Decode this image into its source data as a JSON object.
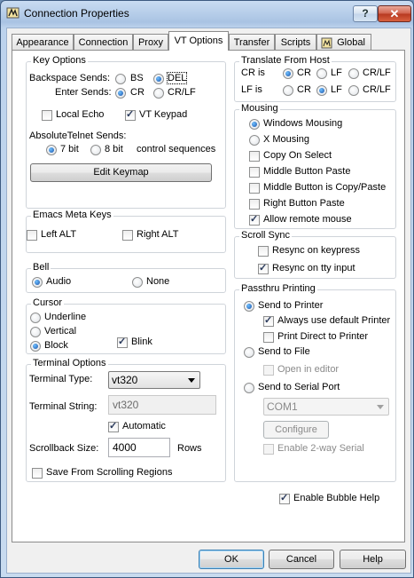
{
  "window": {
    "title": "Connection Properties",
    "help_glyph": "?",
    "close_glyph": "✕"
  },
  "tabs": [
    "Appearance",
    "Connection",
    "Proxy",
    "VT Options",
    "Transfer",
    "Scripts",
    "Global"
  ],
  "key_options": {
    "title": "Key Options",
    "backspace_label": "Backspace Sends:",
    "bs": "BS",
    "del": "DEL",
    "enter_label": "Enter Sends:",
    "cr": "CR",
    "crlf": "CR/LF",
    "local_echo": "Local Echo",
    "vt_keypad": "VT Keypad",
    "abs_telnet_label": "AbsoluteTelnet Sends:",
    "bit7": "7 bit",
    "bit8": "8 bit",
    "control_seq": "control sequences",
    "edit_keymap": "Edit Keymap"
  },
  "emacs": {
    "title": "Emacs Meta Keys",
    "left_alt": "Left ALT",
    "right_alt": "Right ALT"
  },
  "bell": {
    "title": "Bell",
    "audio": "Audio",
    "none": "None"
  },
  "cursor": {
    "title": "Cursor",
    "underline": "Underline",
    "vertical": "Vertical",
    "block": "Block",
    "blink": "Blink"
  },
  "terminal": {
    "title": "Terminal Options",
    "type_label": "Terminal Type:",
    "type_value": "vt320",
    "string_label": "Terminal String:",
    "string_value": "vt320",
    "automatic": "Automatic",
    "scrollback_label": "Scrollback Size:",
    "scrollback_value": "4000",
    "rows": "Rows",
    "save_scrolling": "Save From Scrolling Regions"
  },
  "translate": {
    "title": "Translate From Host",
    "cr_is": "CR is",
    "lf_is": "LF is",
    "cr": "CR",
    "lf": "LF",
    "crlf": "CR/LF"
  },
  "mousing": {
    "title": "Mousing",
    "windows": "Windows Mousing",
    "x": "X Mousing",
    "copy_on_select": "Copy On Select",
    "middle_paste": "Middle Button Paste",
    "middle_copy_paste": "Middle Button is Copy/Paste",
    "right_paste": "Right Button Paste",
    "allow_remote": "Allow remote mouse"
  },
  "scroll_sync": {
    "title": "Scroll Sync",
    "resync_keypress": "Resync on keypress",
    "resync_tty": "Resync on tty input"
  },
  "passthru": {
    "title": "Passthru Printing",
    "send_printer": "Send to Printer",
    "default_printer": "Always use default Printer",
    "print_direct": "Print Direct to Printer",
    "send_file": "Send to File",
    "open_editor": "Open in editor",
    "send_serial": "Send to Serial Port",
    "com_value": "COM1",
    "configure": "Configure",
    "two_way": "Enable 2-way Serial"
  },
  "bubble_help": "Enable Bubble Help",
  "buttons": {
    "ok": "OK",
    "cancel": "Cancel",
    "help": "Help"
  }
}
